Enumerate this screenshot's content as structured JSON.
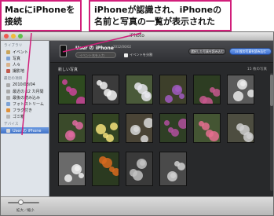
{
  "window": {
    "title": "iPhoto"
  },
  "sidebar": {
    "sections": [
      {
        "heading": "ライブラリ",
        "items": [
          {
            "label": "イベント",
            "color": "#c9a55a"
          },
          {
            "label": "写真",
            "color": "#7ea3d6"
          },
          {
            "label": "人々",
            "color": "#d9b38c"
          },
          {
            "label": "撮影地",
            "color": "#c25b4f"
          }
        ]
      },
      {
        "heading": "最近の項目",
        "items": [
          {
            "label": "2010/08/04",
            "color": "#a8a8a8"
          },
          {
            "label": "最近の 12 カ月間",
            "color": "#a8a8a8"
          },
          {
            "label": "最後の読み込み",
            "color": "#a8a8a8"
          },
          {
            "label": "フォトストリーム",
            "color": "#7ea3d6"
          },
          {
            "label": "フラグ付き",
            "color": "#e0913a"
          },
          {
            "label": "ゴミ箱",
            "color": "#b5b5b5"
          }
        ]
      },
      {
        "heading": "デバイス",
        "items": [
          {
            "label": "User の iPhone",
            "color": "#d8d8d8",
            "selected": true
          }
        ]
      }
    ]
  },
  "header": {
    "device_name": "User の iPhone",
    "device_date": "2012/06/02",
    "event_placeholder": "イベント名を入力",
    "split_label": "イベントを分割",
    "delete_button": "選択した写真を読み込む",
    "import_button": "15 枚の写真を読み込む"
  },
  "grid": {
    "section_label": "新しい写真",
    "count_label": "15 枚の写真"
  },
  "bottombar": {
    "zoom_label": "拡大／縮小"
  },
  "callouts": {
    "left": "MacにiPhoneを接続",
    "right": "iPhoneが認識され、iPhoneの名前と写真の一覧が表示された"
  },
  "colors": {
    "callout_border": "#d11e7a",
    "accent": "#3d6fd1"
  }
}
